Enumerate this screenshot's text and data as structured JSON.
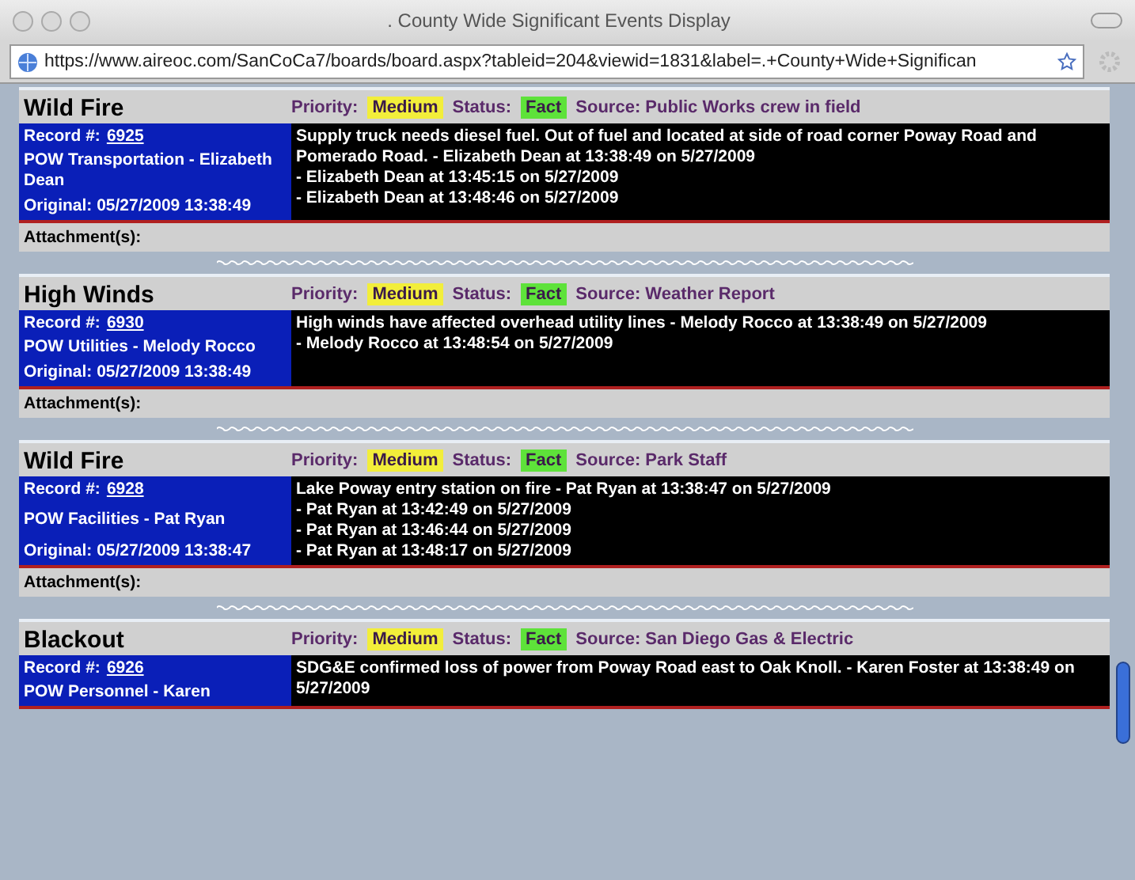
{
  "window": {
    "title": ". County Wide Significant Events Display",
    "url": "https://www.aireoc.com/SanCoCa7/boards/board.aspx?tableid=204&viewid=1831&label=.+County+Wide+Significan"
  },
  "events": [
    {
      "type": "Wild Fire",
      "priority_label": "Priority:",
      "priority": "Medium",
      "status_label": "Status:",
      "status": "Fact",
      "source": "Source: Public Works crew in field",
      "record_label": "Record #:",
      "record": "6925",
      "owner": "POW Transportation  - Elizabeth Dean",
      "original": "Original: 05/27/2009 13:38:49",
      "notes": [
        "Supply truck needs diesel fuel. Out of fuel and located at side of road corner Poway Road and Pomerado Road. - Elizabeth Dean at 13:38:49 on 5/27/2009",
        "- Elizabeth Dean at 13:45:15 on 5/27/2009",
        "- Elizabeth Dean at 13:48:46 on 5/27/2009"
      ],
      "attachments": "Attachment(s):"
    },
    {
      "type": "High Winds",
      "priority_label": "Priority:",
      "priority": "Medium",
      "status_label": "Status:",
      "status": "Fact",
      "source": "Source: Weather Report",
      "record_label": "Record #:",
      "record": "6930",
      "owner": "POW Utilities  - Melody Rocco",
      "original": "Original: 05/27/2009 13:38:49",
      "notes": [
        "High winds have affected overhead utility lines - Melody Rocco at 13:38:49 on 5/27/2009",
        "- Melody Rocco at 13:48:54 on 5/27/2009"
      ],
      "attachments": "Attachment(s):"
    },
    {
      "type": "Wild Fire",
      "priority_label": "Priority:",
      "priority": "Medium",
      "status_label": "Status:",
      "status": "Fact",
      "source": "Source: Park Staff",
      "record_label": "Record #:",
      "record": "6928",
      "owner": "POW Facilities  - Pat Ryan",
      "original": "Original: 05/27/2009 13:38:47",
      "notes": [
        "Lake Poway entry station on fire - Pat Ryan at 13:38:47 on 5/27/2009",
        "- Pat Ryan at 13:42:49 on 5/27/2009",
        "- Pat Ryan at 13:46:44 on 5/27/2009",
        "- Pat Ryan at 13:48:17 on 5/27/2009"
      ],
      "attachments": "Attachment(s):"
    },
    {
      "type": "Blackout",
      "priority_label": "Priority:",
      "priority": "Medium",
      "status_label": "Status:",
      "status": "Fact",
      "source": "Source: San Diego Gas & Electric",
      "record_label": "Record #:",
      "record": "6926",
      "owner": "POW Personnel  - Karen",
      "notes": [
        "SDG&E confirmed loss of power from Poway Road east to Oak Knoll. - Karen Foster at 13:38:49 on 5/27/2009"
      ]
    }
  ]
}
